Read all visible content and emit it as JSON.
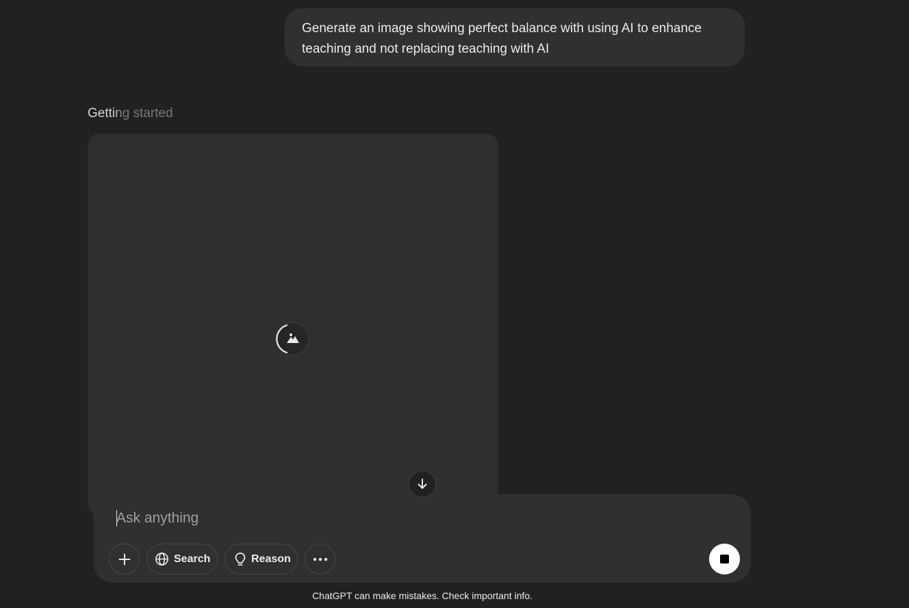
{
  "conversation": {
    "user_message": "Generate an image showing perfect balance with using AI to enhance teaching and not replacing teaching with AI",
    "assistant_status": "Getting started"
  },
  "image_generation": {
    "state_icon": "image-loading-spinner-icon"
  },
  "composer": {
    "placeholder": "Ask anything",
    "value": "",
    "buttons": {
      "add_icon": "plus-icon",
      "search_label": "Search",
      "search_icon": "globe-icon",
      "reason_label": "Reason",
      "reason_icon": "lightbulb-icon",
      "more_icon": "ellipsis-icon",
      "stop_icon": "stop-icon"
    }
  },
  "footer": {
    "disclaimer": "ChatGPT can make mistakes. Check important info."
  },
  "colors": {
    "background": "#212121",
    "bubble": "#303030",
    "image_card": "#2f2f2f",
    "text": "#ececec",
    "stop_button": "#ffffff"
  }
}
